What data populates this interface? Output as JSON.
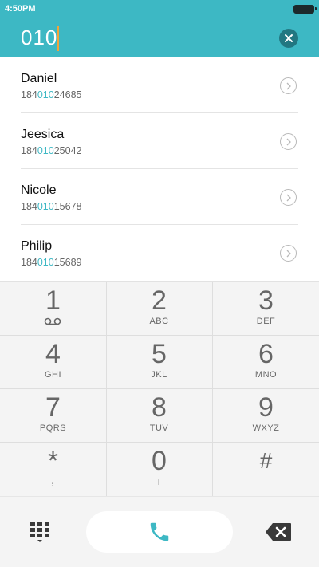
{
  "status_bar": {
    "time": "4:50PM"
  },
  "dialer": {
    "number": "010"
  },
  "contacts": [
    {
      "name": "Daniel",
      "number_prefix": "184",
      "number_match": "010",
      "number_suffix": "24685"
    },
    {
      "name": "Jeesica",
      "number_prefix": "184",
      "number_match": "010",
      "number_suffix": "25042"
    },
    {
      "name": "Nicole",
      "number_prefix": "184",
      "number_match": "010",
      "number_suffix": "15678"
    },
    {
      "name": "Philip",
      "number_prefix": "184",
      "number_match": "010",
      "number_suffix": "15689"
    }
  ],
  "keypad": {
    "keys": [
      {
        "digit": "1",
        "letters": ""
      },
      {
        "digit": "2",
        "letters": "ABC"
      },
      {
        "digit": "3",
        "letters": "DEF"
      },
      {
        "digit": "4",
        "letters": "GHI"
      },
      {
        "digit": "5",
        "letters": "JKL"
      },
      {
        "digit": "6",
        "letters": "MNO"
      },
      {
        "digit": "7",
        "letters": "PQRS"
      },
      {
        "digit": "8",
        "letters": "TUV"
      },
      {
        "digit": "9",
        "letters": "WXYZ"
      },
      {
        "digit": "*",
        "letters": ","
      },
      {
        "digit": "0",
        "letters": "+"
      },
      {
        "digit": "#",
        "letters": ""
      }
    ]
  },
  "icons": {
    "clear": "close-icon",
    "contact_detail": "chevron-right-icon",
    "voicemail": "voicemail-icon",
    "keypad_toggle": "dialpad-icon",
    "call": "phone-icon",
    "backspace": "backspace-icon",
    "battery": "battery-icon"
  },
  "colors": {
    "accent": "#3db8c4",
    "clear_button": "#227781",
    "caret": "#f2a43a",
    "keypad_background": "#f4f4f4"
  }
}
